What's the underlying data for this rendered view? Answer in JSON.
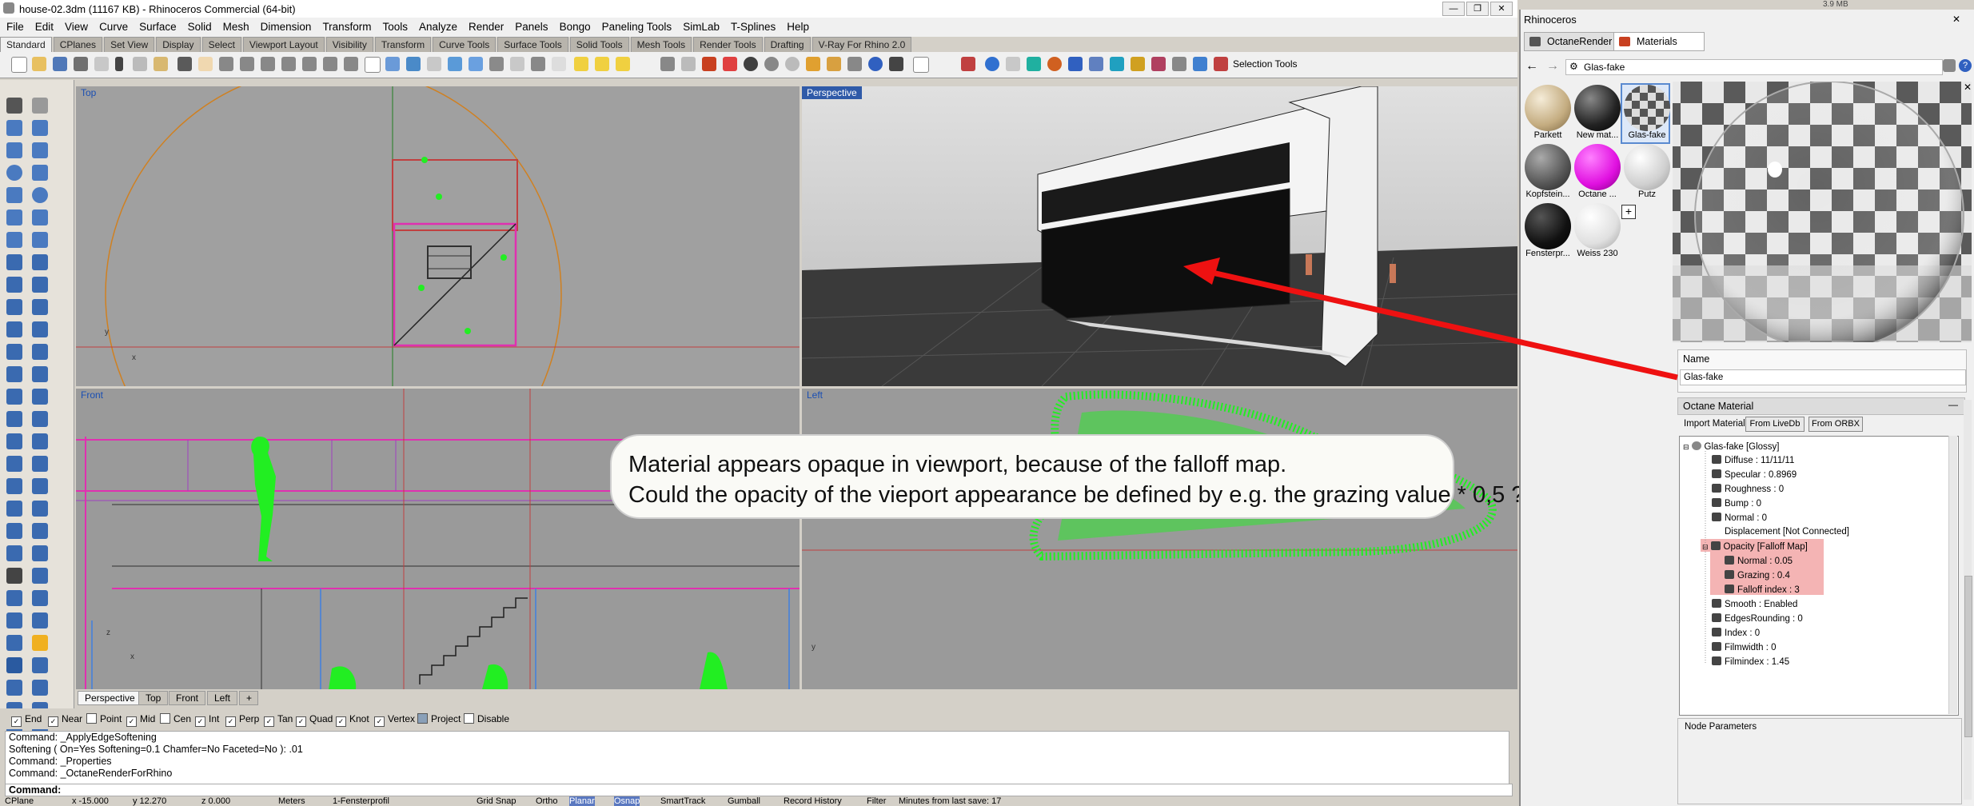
{
  "window": {
    "title": "house-02.3dm (11167 KB) - Rhinoceros Commercial (64-bit)",
    "min": "—",
    "restore": "❐",
    "close": "✕"
  },
  "top_strip": {
    "text": "3.9 MB"
  },
  "menu": [
    "File",
    "Edit",
    "View",
    "Curve",
    "Surface",
    "Solid",
    "Mesh",
    "Dimension",
    "Transform",
    "Tools",
    "Analyze",
    "Render",
    "Panels",
    "Bongo",
    "Paneling Tools",
    "SimLab",
    "T-Splines",
    "Help"
  ],
  "toolbar_tabs": [
    "Standard",
    "CPlanes",
    "Set View",
    "Display",
    "Select",
    "Viewport Layout",
    "Visibility",
    "Transform",
    "Curve Tools",
    "Surface Tools",
    "Solid Tools",
    "Mesh Tools",
    "Render Tools",
    "Drafting",
    "V-Ray For Rhino 2.0"
  ],
  "selection_tools": "Selection Tools",
  "viewports": {
    "top": "Top",
    "perspective": "Perspective",
    "front": "Front",
    "left": "Left"
  },
  "axis": {
    "x": "x",
    "y": "y",
    "z": "z"
  },
  "viewport_tabs": [
    "Perspective",
    "Top",
    "Front",
    "Left"
  ],
  "osnaps": [
    {
      "label": "End",
      "checked": true
    },
    {
      "label": "Near",
      "checked": true
    },
    {
      "label": "Point",
      "checked": false
    },
    {
      "label": "Mid",
      "checked": true
    },
    {
      "label": "Cen",
      "checked": false
    },
    {
      "label": "Int",
      "checked": true
    },
    {
      "label": "Perp",
      "checked": true
    },
    {
      "label": "Tan",
      "checked": true
    },
    {
      "label": "Quad",
      "checked": true
    },
    {
      "label": "Knot",
      "checked": true
    },
    {
      "label": "Vertex",
      "checked": true
    },
    {
      "label": "Project",
      "checked": false
    },
    {
      "label": "Disable",
      "checked": false
    }
  ],
  "command_history": [
    "Command: _ApplyEdgeSoftening",
    "Softening ( On=Yes  Softening=0.1  Chamfer=No  Faceted=No ): .01",
    "Command: _Properties",
    "Command: _OctaneRenderForRhino"
  ],
  "command_prompt": "Command:",
  "status": {
    "cplane": "CPlane",
    "x": "x -15.000",
    "y": "y 12.270",
    "z": "z 0.000",
    "units": "Meters",
    "layer": "1-Fensterprofil",
    "grid_snap": "Grid Snap",
    "ortho": "Ortho",
    "planar": "Planar",
    "osnap": "Osnap",
    "smarttrack": "SmartTrack",
    "gumball": "Gumball",
    "record_history": "Record History",
    "filter": "Filter",
    "minutes": "Minutes from last save: 17"
  },
  "panel": {
    "title": "Rhinoceros",
    "tabs": [
      "OctaneRender",
      "Materials"
    ],
    "current_material": "Glas-fake",
    "materials": [
      {
        "label": "Parkett",
        "color": "#d8c8a0"
      },
      {
        "label": "New mat...",
        "color": "#333333"
      },
      {
        "label": "Glas-fake",
        "color": "#b8b8b8"
      },
      {
        "label": "Kopfstein...",
        "color": "#6a6a6a"
      },
      {
        "label": "Octane ...",
        "color": "#e010e0"
      },
      {
        "label": "Putz",
        "color": "#d8d8d8"
      },
      {
        "label": "Fensterpr...",
        "color": "#181818"
      },
      {
        "label": "Weiss 230",
        "color": "#e6e6e6"
      }
    ],
    "add": "+",
    "name_label": "Name",
    "name_value": "Glas-fake",
    "octane_header": "Octane Material",
    "collapse": "—",
    "import_label": "Import Material:",
    "from_livedb": "From LiveDb",
    "from_orbx": "From ORBX",
    "tree": [
      {
        "text": "Glas-fake  [Glossy]",
        "level": 0
      },
      {
        "text": "Diffuse : 11/11/11",
        "level": 1
      },
      {
        "text": "Specular : 0.8969",
        "level": 1
      },
      {
        "text": "Roughness : 0",
        "level": 1
      },
      {
        "text": "Bump : 0",
        "level": 1
      },
      {
        "text": "Normal : 0",
        "level": 1
      },
      {
        "text": "Displacement  [Not Connected]",
        "level": 1
      },
      {
        "text": "Opacity  [Falloff Map]",
        "level": 1
      },
      {
        "text": "Normal : 0.05",
        "level": 2
      },
      {
        "text": "Grazing : 0.4",
        "level": 2
      },
      {
        "text": "Falloff index : 3",
        "level": 2
      },
      {
        "text": "Smooth : Enabled",
        "level": 1
      },
      {
        "text": "EdgesRounding : 0",
        "level": 1
      },
      {
        "text": "Index : 0",
        "level": 1
      },
      {
        "text": "Filmwidth : 0",
        "level": 1
      },
      {
        "text": "Filmindex : 1.45",
        "level": 1
      }
    ],
    "node_params": "Node Parameters"
  },
  "annotation": {
    "line1": "Material appears opaque in viewport, because of the falloff map.",
    "line2": "Could the opacity of the vieport appearance be defined by e.g. the grazing value * 0,5 ?"
  },
  "colors": {
    "arrow": "#ee1111",
    "highlight": "#f4b4b4",
    "active_viewport": "#2f5aa8",
    "figure_green": "#22ee22"
  }
}
